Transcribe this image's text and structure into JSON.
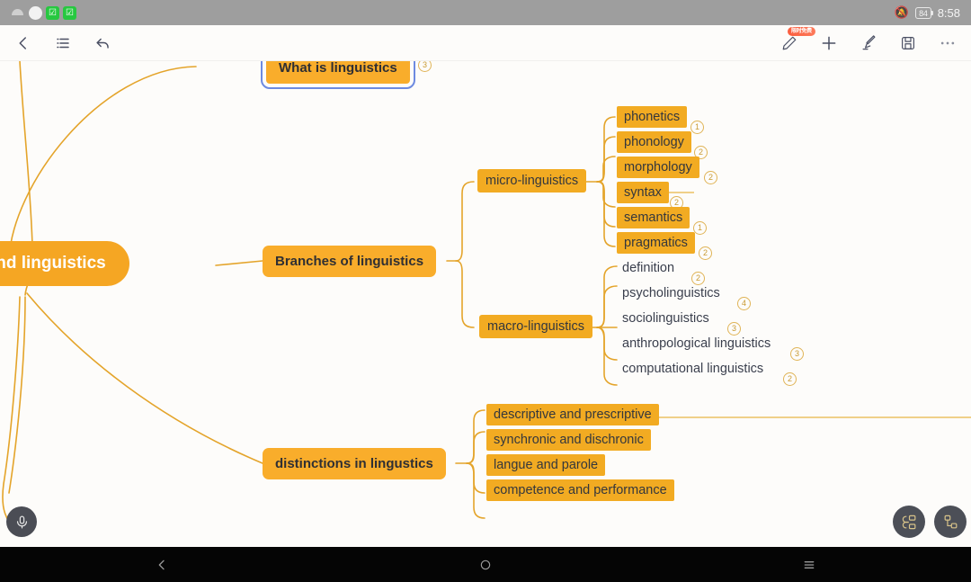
{
  "statusbar": {
    "app_icons": [
      "wifi-icon",
      "chat-bubble-icon",
      "wechat-icon",
      "wechat-icon-2"
    ],
    "notification_icon": "bell-off-icon",
    "battery_level": "84",
    "time": "8:58"
  },
  "toolbar": {
    "back_label": "back-icon",
    "outline_label": "outline-icon",
    "undo_label": "undo-icon",
    "pen_label": "pen-icon",
    "pen_badge": "限时免费",
    "add_label": "add-icon",
    "highlighter_label": "highlighter-icon",
    "save_label": "save-icon",
    "more_label": "more-icon"
  },
  "mindmap": {
    "root": {
      "label": "language and linguistics"
    },
    "branches": [
      {
        "label": "What is linguistics",
        "selected": true,
        "count": "3",
        "children": []
      },
      {
        "label": "Branches of linguistics",
        "selected": false,
        "count": "",
        "children": [
          {
            "label": "micro-linguistics",
            "style": "filled",
            "children": [
              {
                "label": "phonetics",
                "count": "1",
                "style": "filled"
              },
              {
                "label": "phonology",
                "count": "2",
                "style": "filled"
              },
              {
                "label": "morphology",
                "count": "2",
                "style": "filled"
              },
              {
                "label": "syntax",
                "count": "2",
                "style": "filled"
              },
              {
                "label": "semantics",
                "count": "1",
                "style": "filled"
              },
              {
                "label": "pragmatics",
                "count": "2",
                "style": "filled"
              }
            ]
          },
          {
            "label": "macro-linguistics",
            "style": "filled",
            "children": [
              {
                "label": "definition",
                "count": "2",
                "style": "plain"
              },
              {
                "label": "psycholinguistics",
                "count": "4",
                "style": "plain"
              },
              {
                "label": "sociolinguistics",
                "count": "3",
                "style": "plain"
              },
              {
                "label": "anthropological linguistics",
                "count": "3",
                "style": "plain"
              },
              {
                "label": "computational linguistics",
                "count": "2",
                "style": "plain"
              }
            ]
          }
        ]
      },
      {
        "label": "distinctions in lingustics",
        "selected": false,
        "count": "",
        "children": [
          {
            "label": "descriptive and prescriptive",
            "style": "filled",
            "count": ""
          },
          {
            "label": "synchronic and dischronic",
            "style": "filled",
            "count": ""
          },
          {
            "label": "langue and parole",
            "style": "filled",
            "count": ""
          },
          {
            "label": "competence and performance",
            "style": "filled",
            "count": ""
          }
        ]
      }
    ]
  },
  "floating": {
    "mic_label": "microphone-icon",
    "layout_balanced_label": "layout-balanced-icon",
    "layout_tree_label": "layout-tree-icon"
  },
  "navbar": {
    "back": "nav-back-icon",
    "home": "nav-home-icon",
    "recents": "nav-recents-icon"
  },
  "colors": {
    "accent": "#f5a623",
    "node_fill": "#f2ab22",
    "link": "#e4a42a",
    "selection": "#6d8ae0",
    "badge": "#fb5d3e"
  }
}
